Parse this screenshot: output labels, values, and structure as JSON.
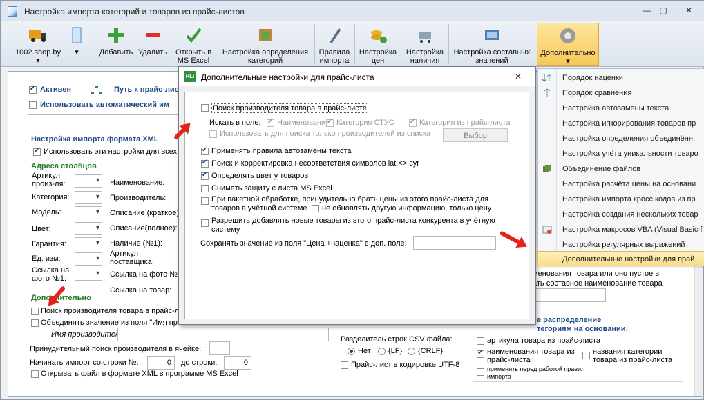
{
  "window": {
    "title": "Настройка импорта категорий и товаров из прайс-листов",
    "min": "—",
    "max": "▢",
    "close": "✕"
  },
  "ribbon": {
    "shop": "1002.shop.by",
    "add": "Добавить",
    "del": "Удалить",
    "open1": "Открыть в",
    "open2": "MS Excel",
    "cat1": "Настройка определения",
    "cat2": "категорий",
    "rules1": "Правила",
    "rules2": "импорта",
    "price1": "Настройка",
    "price2": "цен",
    "avail1": "Настройка",
    "avail2": "наличия",
    "comp1": "Настройка составных",
    "comp2": "значений",
    "extra": "Дополнительно",
    "chev": "▾"
  },
  "main": {
    "active": "Активен",
    "path": "Путь к прайс-лист",
    "auto": "Использовать автоматический им",
    "xml_hdr": "Настройка импорта формата XML",
    "xml_use": "Использовать эти настройки для всех",
    "cols_hdr": "Адреса столбцов",
    "left_labels": [
      "Артикул произ-ля:",
      "Категория:",
      "Модель:",
      "Цвет:",
      "Гарантия:",
      "Ед. изм:",
      "Ссылка на фото №1:"
    ],
    "right_labels": [
      "Наименование:",
      "Производитель:",
      "Описание (краткое)",
      "Описание(полное):",
      "Наличие (№1):",
      "Артикул поставщика:",
      "Ссылка на фото №",
      "Ссылка на товар:"
    ],
    "extra_hdr": "Дополнительно",
    "find_mfr": "Поиск производителя товара в прайс-л",
    "merge": "Объединять значение из поля \"Имя про",
    "mfr_name": "Имя производителя:",
    "forced": "Принудительный поиск производителя в ячейке:",
    "start_row": "Начинать импорт со строки №:",
    "start_val": "0",
    "to_row": "до строки:",
    "to_val": "0",
    "open_xml": "Открывать файл в формате XML в программе MS Excel",
    "csv_sep": "Разделитель строк CSV файла:",
    "r_no": "Нет",
    "r_lf": "{LF}",
    "r_crlf": "{CRLF}",
    "utf8": "Прайс-лист в кодировке UTF-8",
    "name_note1": "менования товара или оно пустое в",
    "name_note2": "ать составное наименование товара",
    "dist1": "е распределение",
    "dist2": "тегориям на основании:",
    "by_art": "артикула товара из прайс-листа",
    "by_name1": "наименования товара из",
    "by_name2": "прайс-листа",
    "by_cat1": "названия категории",
    "by_cat2": "товара из прайс-листа",
    "apply1": "применить перед работой правил",
    "apply2": "импорта"
  },
  "dialog": {
    "title": "Дополнительные настройки для прайс-листа",
    "icon": "PLi",
    "close": "✕",
    "find": "Поиск производителя товара в прайс-листе",
    "search_in": "Искать в поле:",
    "f_name": "Наименование",
    "f_cat": "Категория СТУС",
    "f_catpl": "Категория из прайс-листа",
    "only_list": "Использовать для поиска только производителей из списка",
    "choose": "Выбор",
    "autoreplace": "Применять правила автозамены текста",
    "latcyr": "Поиск и корректировка несоответствия символов lat <> cyr",
    "color": "Определять цвет у товаров",
    "unprotect": "Снимать защиту с листа MS Excel",
    "batch1": "При пакетной обработке, принудительно брать цены из этого прайс-листа для",
    "batch2": "товаров в учётной системе",
    "noupdate": "не обновлять другую информацию, только цену",
    "allownew1": "Разрешить добавлять новые товары из этого прайс-листа конкурента в учётную",
    "allownew2": "систему",
    "save": "Сохранять значение из поля \"Цена +наценка\" в доп. поле:"
  },
  "menu": {
    "items": [
      "Порядок наценки",
      "Порядок сравнения",
      "Настройка автозамены текста",
      "Настройка игнорирования товаров пр",
      "Настройка определения объединённ",
      "Настройка учёта уникальности товаро",
      "Объединение файлов",
      "Настройка расчёта цены на основани",
      "Настройка импорта кросс кодов из пр",
      "Настройка создания нескольких товар",
      "Настройка макросов VBA (Visual Basic f",
      "Настройка регулярных выражений",
      "Дополнительные настройки для прай"
    ]
  },
  "colors": {
    "accent": "#1e4a86",
    "arrow": "#e2241b",
    "selected": "#f9dc86"
  }
}
